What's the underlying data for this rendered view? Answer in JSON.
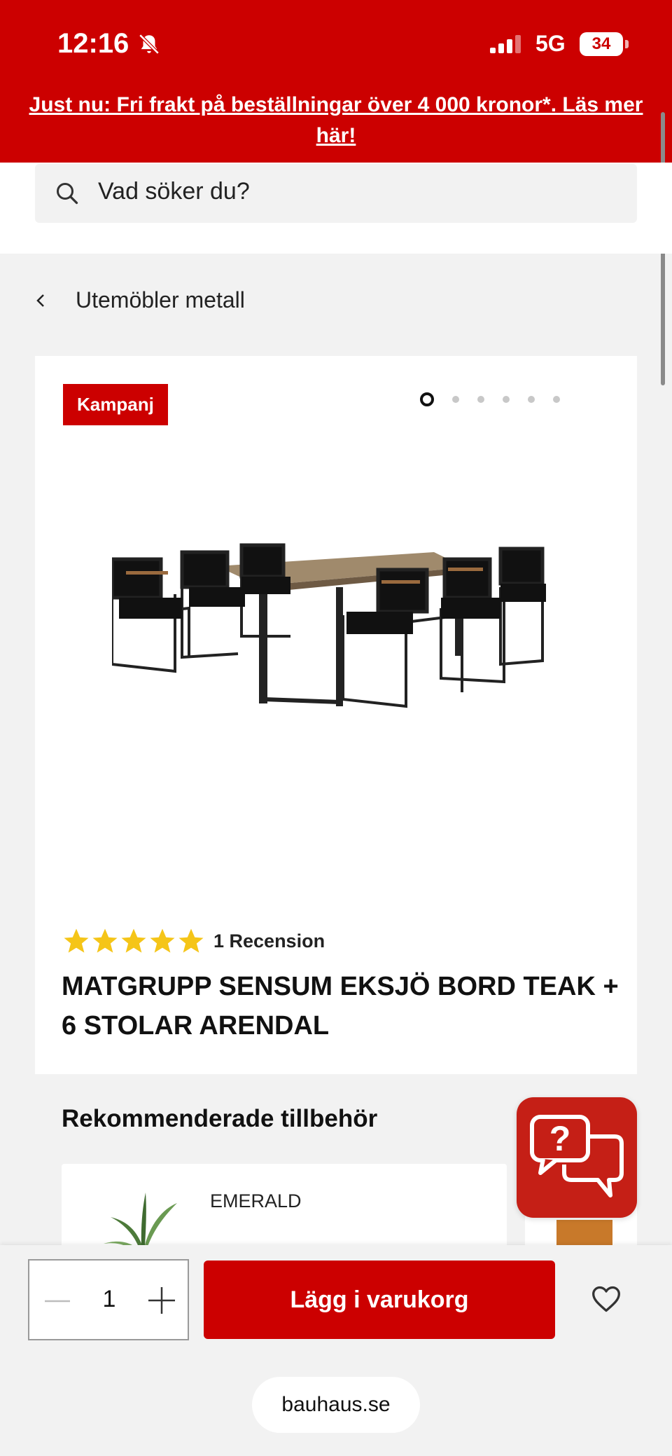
{
  "status_bar": {
    "time": "12:16",
    "network": "5G",
    "battery": "34"
  },
  "promo": {
    "text": "Just nu: Fri frakt på beställningar över 4 000 kronor*. Läs mer här!"
  },
  "search": {
    "placeholder": "Vad söker du?"
  },
  "breadcrumb": {
    "label": "Utemöbler metall"
  },
  "product": {
    "badge": "Kampanj",
    "image_count": 6,
    "active_image": 1,
    "rating": 5,
    "review_count_label": "1 Recension",
    "title": "MATGRUPP SENSUM EKSJÖ BORD TEAK + 6 STOLAR ARENDAL"
  },
  "recommended": {
    "title": "Rekommenderade tillbehör",
    "items": [
      {
        "brand": "EMERALD"
      }
    ]
  },
  "cart": {
    "quantity": "1",
    "add_label": "Lägg i varukorg"
  },
  "browser": {
    "url": "bauhaus.se"
  },
  "colors": {
    "brand_red": "#cc0000",
    "star": "#f5c518"
  }
}
